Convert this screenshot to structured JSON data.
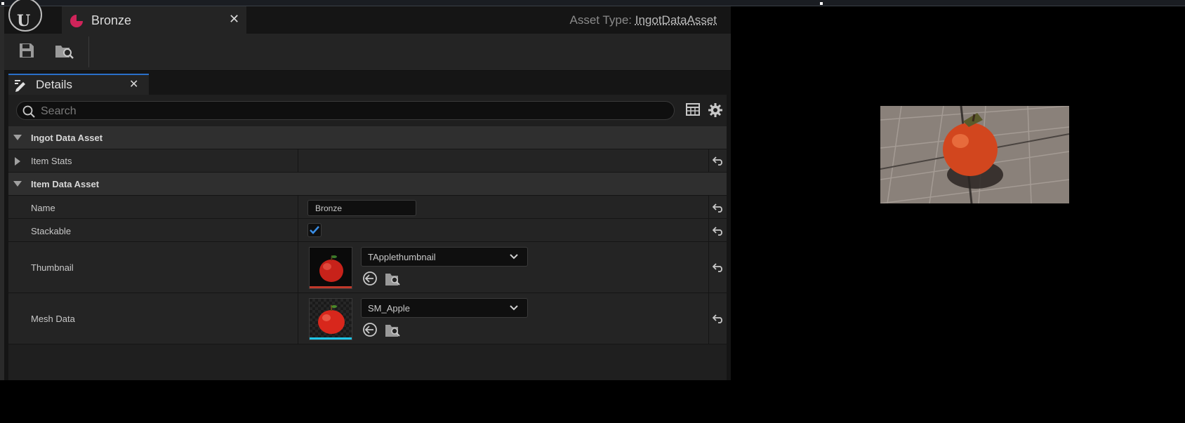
{
  "document_tab": {
    "title": "Bronze"
  },
  "asset_type": {
    "label": "Asset Type:",
    "value": "IngotDataAsset"
  },
  "details_tab": {
    "title": "Details"
  },
  "search": {
    "placeholder": "Search"
  },
  "categories": {
    "ingot": "Ingot Data Asset",
    "item": "Item Data Asset"
  },
  "properties": {
    "item_stats": "Item Stats",
    "name": {
      "label": "Name",
      "value": "Bronze"
    },
    "stackable": {
      "label": "Stackable",
      "checked": true
    },
    "thumbnail": {
      "label": "Thumbnail",
      "asset": "TApplethumbnail",
      "accent": "#c0392b"
    },
    "mesh_data": {
      "label": "Mesh Data",
      "asset": "SM_Apple",
      "accent": "#1fc6e8"
    }
  },
  "icons": [
    "unreal-logo-icon",
    "save-icon",
    "browse-asset-icon",
    "pencil-icon",
    "search-icon",
    "table-view-icon",
    "gear-icon",
    "reset-arrow-icon",
    "use-selected-icon",
    "chevron-down-icon"
  ],
  "colors": {
    "accent_blue": "#2a6fc9",
    "tab_icon": "#d0245a",
    "checkmark": "#3a8ee6"
  }
}
